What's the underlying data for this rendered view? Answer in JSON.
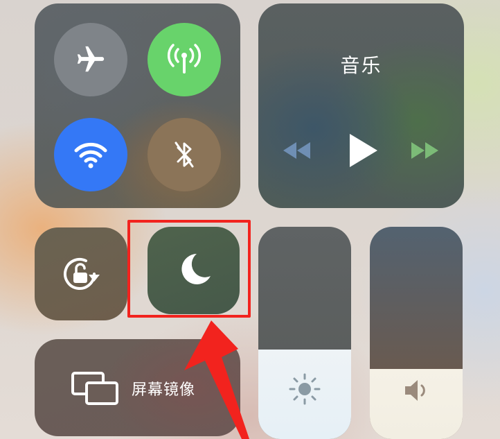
{
  "music": {
    "title": "音乐"
  },
  "screen_mirroring": {
    "label": "屏幕镜像"
  },
  "brightness": {
    "level": 0.42
  },
  "volume": {
    "level": 0.33
  },
  "icons": {
    "airplane": "airplane-icon",
    "cellular": "cellular-antenna-icon",
    "wifi": "wifi-icon",
    "bluetooth": "bluetooth-off-icon",
    "rewind": "rewind-icon",
    "play": "play-icon",
    "forward": "fast-forward-icon",
    "rotation_lock": "rotation-lock-icon",
    "do_not_disturb": "moon-icon",
    "screen_mirroring": "screen-mirroring-icon",
    "brightness": "sun-icon",
    "volume": "speaker-icon"
  },
  "colors": {
    "cellular_active": "#68d36b",
    "wifi_active": "#3478f6",
    "highlight": "#f2231e"
  }
}
